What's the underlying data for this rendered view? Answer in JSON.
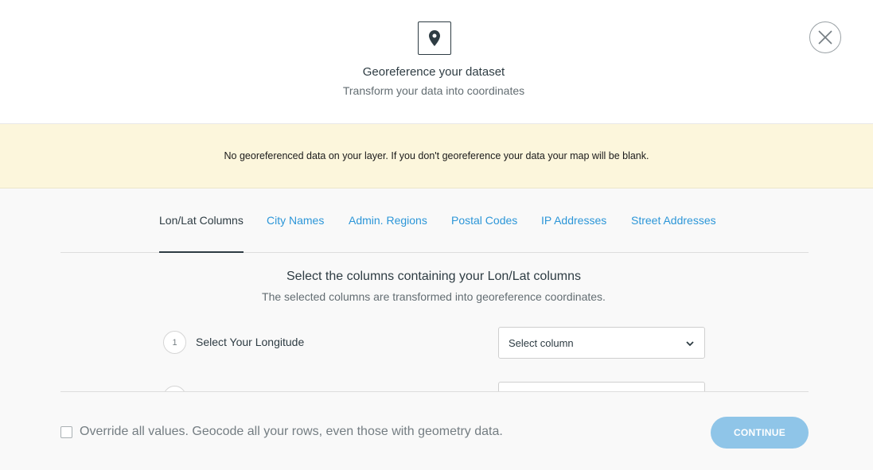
{
  "header": {
    "icon": "map-pin-icon",
    "title": "Georeference your dataset",
    "subtitle": "Transform your data into coordinates",
    "close_icon": "close-icon"
  },
  "warning": {
    "text": "No georeferenced data on your layer. If you don't georeference your data your map will be blank."
  },
  "tabs": [
    {
      "label": "Lon/Lat Columns",
      "active": true
    },
    {
      "label": "City Names",
      "active": false
    },
    {
      "label": "Admin. Regions",
      "active": false
    },
    {
      "label": "Postal Codes",
      "active": false
    },
    {
      "label": "IP Addresses",
      "active": false
    },
    {
      "label": "Street Addresses",
      "active": false
    }
  ],
  "content": {
    "title": "Select the columns containing your Lon/Lat columns",
    "description": "The selected columns are transformed into georeference coordinates.",
    "steps": [
      {
        "number": "1",
        "label": "Select Your Longitude",
        "select_value": "Select column"
      }
    ]
  },
  "footer": {
    "override_label": "Override all values. Geocode all your rows, even those with geometry data.",
    "override_checked": false,
    "continue_label": "CONTINUE"
  },
  "colors": {
    "accent": "#2c96d8",
    "warning_bg": "#fcf6dc",
    "button_disabled": "#8fc5e8",
    "text_primary": "#2e3c43"
  }
}
